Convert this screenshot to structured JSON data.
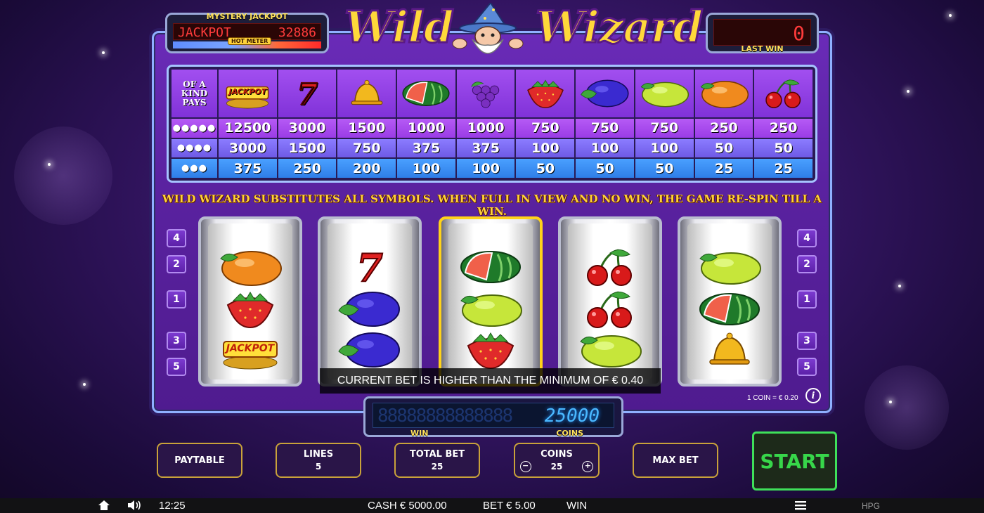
{
  "jackpot": {
    "title": "MYSTERY JACKPOT",
    "display_label": "JACKPOT",
    "value": "32886",
    "meter_label": "HOT METER"
  },
  "logo": {
    "left_text": "Wild",
    "right_text": "Wizard"
  },
  "last_win": {
    "value": "0",
    "label": "LAST WIN"
  },
  "paytable": {
    "header_label": "OF A KIND PAYS",
    "symbols": [
      "jackpot",
      "seven",
      "bell",
      "watermelon",
      "grapes",
      "strawberry",
      "plum",
      "lemon",
      "orange",
      "cherries"
    ],
    "jackpot_symbol_text": "JACKPOT",
    "rows": [
      {
        "label": "●●●●●",
        "values": [
          "12500",
          "3000",
          "1500",
          "1000",
          "1000",
          "750",
          "750",
          "750",
          "250",
          "250"
        ]
      },
      {
        "label": "●●●●",
        "values": [
          "3000",
          "1500",
          "750",
          "375",
          "375",
          "100",
          "100",
          "100",
          "50",
          "50"
        ]
      },
      {
        "label": "●●●",
        "values": [
          "375",
          "250",
          "200",
          "100",
          "100",
          "50",
          "50",
          "50",
          "25",
          "25"
        ]
      }
    ]
  },
  "notice": "WILD WIZARD SUBSTITUTES ALL SYMBOLS. WHEN FULL IN VIEW AND NO WIN, THE GAME RE-SPIN TILL A WIN.",
  "reels": [
    [
      "orange",
      "strawberry",
      "jackpot"
    ],
    [
      "seven",
      "plum",
      "plum"
    ],
    [
      "watermelon",
      "lemon",
      "strawberry"
    ],
    [
      "cherries",
      "cherries",
      "lemon"
    ],
    [
      "lemon",
      "watermelon",
      "bell"
    ]
  ],
  "line_buttons": {
    "left": [
      "4",
      "2",
      "1",
      "3",
      "5"
    ],
    "right": [
      "4",
      "2",
      "1",
      "3",
      "5"
    ]
  },
  "bet_message": "CURRENT BET IS HIGHER THAN THE MINIMUM OF € 0.40",
  "coin_value": "1 COIN = € 0.20",
  "win_display": {
    "coins": "25000",
    "win_label": "WIN",
    "coins_label": "COINS"
  },
  "controls": {
    "paytable": "PAYTABLE",
    "lines_label": "LINES",
    "lines_value": "5",
    "total_bet_label": "TOTAL BET",
    "total_bet_value": "25",
    "coins_label": "COINS",
    "coins_value": "25",
    "minus": "−",
    "plus": "+",
    "max_bet": "MAX BET",
    "start": "START"
  },
  "statusbar": {
    "time": "12:25",
    "cash": "CASH € 5000.00",
    "bet": "BET € 5.00",
    "win": "WIN",
    "brand": "HPG"
  },
  "colors": {
    "accent_gold": "#ffd23a",
    "start_green": "#37d64a",
    "frame_blue": "#8fb0ff"
  }
}
